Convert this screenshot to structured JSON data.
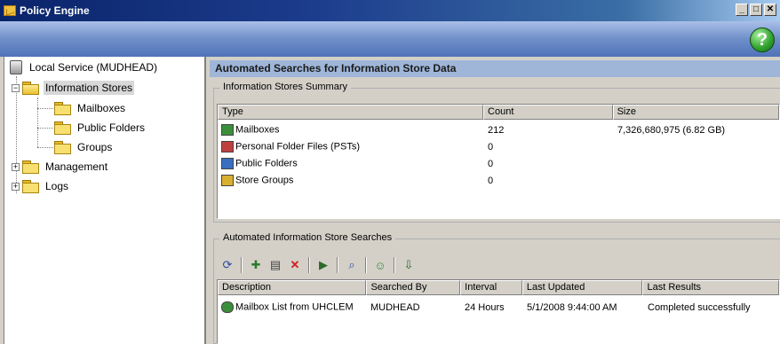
{
  "window": {
    "title": "Policy Engine"
  },
  "window_controls": {
    "minimize": "_",
    "maximize": "□",
    "close": "✕"
  },
  "help": {
    "glyph": "?"
  },
  "tree": {
    "root": "Local Service (MUDHEAD)",
    "items": [
      {
        "label": "Information Stores",
        "expander": "−",
        "icon": "open-folder-icon",
        "selected": true
      },
      {
        "label": "Mailboxes",
        "icon": "folder-icon"
      },
      {
        "label": "Public Folders",
        "icon": "folder-icon"
      },
      {
        "label": "Groups",
        "icon": "folder-icon"
      },
      {
        "label": "Management",
        "expander": "+",
        "icon": "folder-icon"
      },
      {
        "label": "Logs",
        "expander": "+",
        "icon": "folder-icon"
      }
    ]
  },
  "main": {
    "header": "Automated Searches for Information Store Data",
    "summary": {
      "title": "Information Stores Summary",
      "columns": [
        "Type",
        "Count",
        "Size"
      ],
      "rows": [
        {
          "type": "Mailboxes",
          "count": "212",
          "size": "7,326,680,975 (6.82 GB)",
          "icon": "mailbox-icon"
        },
        {
          "type": "Personal Folder Files (PSTs)",
          "count": "0",
          "size": "",
          "icon": "pst-icon"
        },
        {
          "type": "Public Folders",
          "count": "0",
          "size": "",
          "icon": "public-folder-icon"
        },
        {
          "type": "Store Groups",
          "count": "0",
          "size": "",
          "icon": "store-group-icon"
        }
      ]
    },
    "searches": {
      "title": "Automated Information Store Searches",
      "toolbar": [
        {
          "name": "refresh-button",
          "glyph": "⟳"
        },
        {
          "name": "new-search-button",
          "glyph": "✚"
        },
        {
          "name": "properties-button",
          "glyph": "▤"
        },
        {
          "name": "delete-button",
          "glyph": "✕"
        },
        {
          "name": "run-search-button",
          "glyph": "▶"
        },
        {
          "name": "find-button",
          "glyph": "⌕"
        },
        {
          "name": "users-button",
          "glyph": "☺"
        },
        {
          "name": "export-button",
          "glyph": "⇩"
        }
      ],
      "columns": [
        "Description",
        "Searched By",
        "Interval",
        "Last Updated",
        "Last Results"
      ],
      "rows": [
        {
          "description": "Mailbox List from UHCLEM",
          "searched_by": "MUDHEAD",
          "interval": "24 Hours",
          "last_updated": "5/1/2008 9:44:00 AM",
          "last_results": "Completed successfully"
        }
      ]
    }
  }
}
